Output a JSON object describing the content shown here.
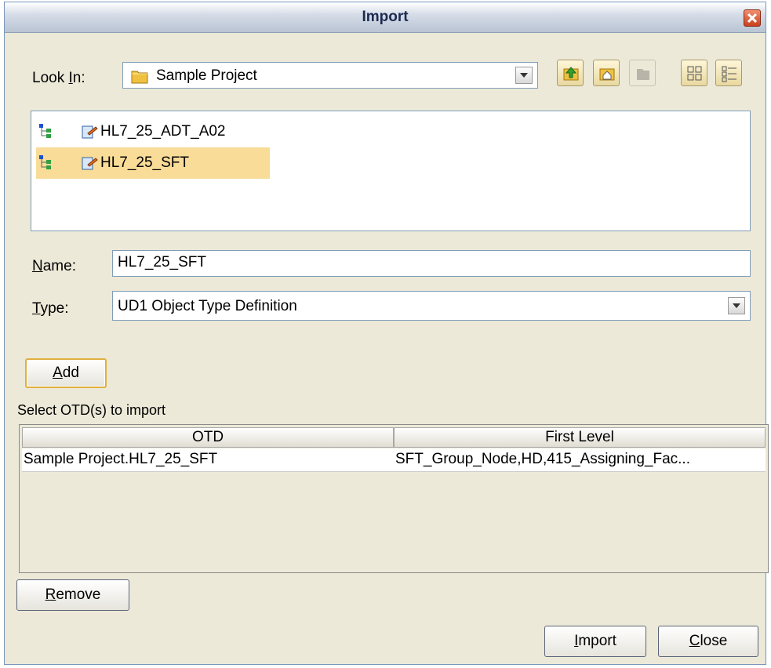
{
  "window": {
    "title": "Import",
    "close_icon": "close-icon"
  },
  "look_in": {
    "label_pre": "Look ",
    "label_key": "I",
    "label_post": "n:",
    "value": "Sample Project",
    "folder_icon": "folder-icon"
  },
  "toolbar": {
    "icons": [
      "up-one-level-icon",
      "home-icon",
      "new-folder-icon",
      "list-view-icon",
      "details-view-icon"
    ]
  },
  "files": [
    {
      "name": "HL7_25_ADT_A02",
      "selected": false
    },
    {
      "name": "HL7_25_SFT",
      "selected": true
    }
  ],
  "name_field": {
    "label_key": "N",
    "label_rest": "ame:",
    "value": "HL7_25_SFT"
  },
  "type_field": {
    "label_key": "T",
    "label_rest": "ype:",
    "value": "UD1 Object Type Definition"
  },
  "add_button": {
    "key": "A",
    "rest": "dd"
  },
  "select_label": "Select OTD(s) to import",
  "table": {
    "columns": [
      "OTD",
      "First Level"
    ],
    "rows": [
      [
        "Sample Project.HL7_25_SFT",
        "SFT_Group_Node,HD,415_Assigning_Fac..."
      ]
    ]
  },
  "remove_button": {
    "key": "R",
    "rest": "emove"
  },
  "import_button": {
    "key": "I",
    "rest": "mport"
  },
  "close_button": {
    "key": "C",
    "rest": "lose"
  },
  "colors": {
    "selection": "#f8dc98",
    "dialog_bg": "#ece9d8",
    "title_text": "#1c2a50",
    "close_red": "#c8401e"
  }
}
